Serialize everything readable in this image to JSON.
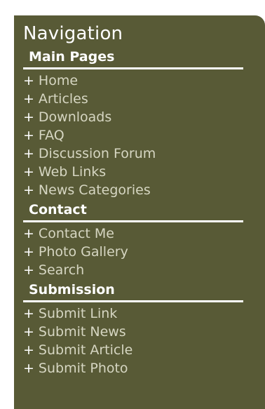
{
  "title": "Navigation",
  "colors": {
    "panel_bg": "#585a36",
    "heading_text": "#ffffff",
    "link_text": "#d6d6c2"
  },
  "sections": [
    {
      "heading": "Main Pages",
      "links": [
        {
          "prefix": "+",
          "label": "Home"
        },
        {
          "prefix": "+",
          "label": "Articles"
        },
        {
          "prefix": "+",
          "label": "Downloads"
        },
        {
          "prefix": "+",
          "label": "FAQ"
        },
        {
          "prefix": "+",
          "label": "Discussion Forum"
        },
        {
          "prefix": "+",
          "label": "Web Links"
        },
        {
          "prefix": "+",
          "label": "News Categories"
        }
      ]
    },
    {
      "heading": "Contact",
      "links": [
        {
          "prefix": "+",
          "label": "Contact Me"
        },
        {
          "prefix": "+",
          "label": "Photo Gallery"
        },
        {
          "prefix": "+",
          "label": "Search"
        }
      ]
    },
    {
      "heading": "Submission",
      "links": [
        {
          "prefix": "+",
          "label": "Submit Link"
        },
        {
          "prefix": "+",
          "label": "Submit News"
        },
        {
          "prefix": "+",
          "label": "Submit Article"
        },
        {
          "prefix": "+",
          "label": "Submit Photo"
        }
      ]
    }
  ]
}
